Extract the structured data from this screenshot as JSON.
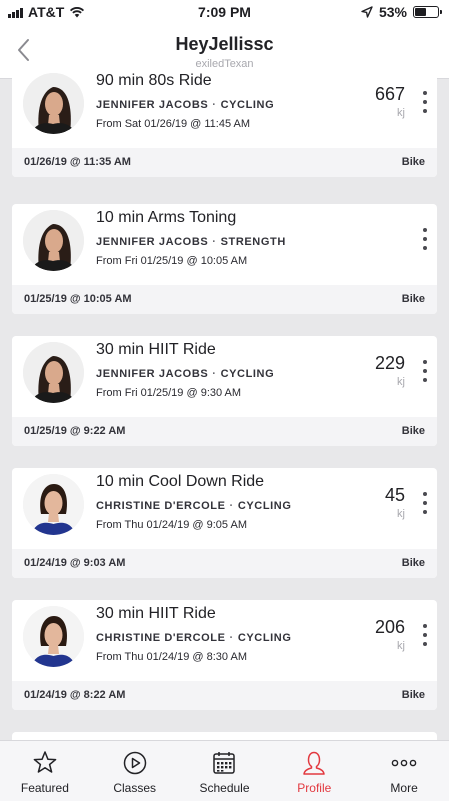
{
  "status_bar": {
    "carrier": "AT&T",
    "time": "7:09 PM",
    "battery_percent": "53%",
    "battery_level": 0.53
  },
  "nav": {
    "title": "HeyJellissc",
    "subtitle": "exiledTexan"
  },
  "rides": [
    {
      "title": "90 min 80s Ride",
      "instructor": "JENNIFER JACOBS",
      "category": "CYCLING",
      "from": "From Sat 01/26/19 @ 11:45 AM",
      "output": "667",
      "unit": "kj",
      "date": "01/26/19 @ 11:35 AM",
      "equipment": "Bike",
      "avatar": "instructor-a"
    },
    {
      "title": "10 min Arms Toning",
      "instructor": "JENNIFER JACOBS",
      "category": "STRENGTH",
      "from": "From Fri 01/25/19 @ 10:05 AM",
      "output": "",
      "unit": "",
      "date": "01/25/19 @ 10:05 AM",
      "equipment": "Bike",
      "avatar": "instructor-a"
    },
    {
      "title": "30 min HIIT Ride",
      "instructor": "JENNIFER JACOBS",
      "category": "CYCLING",
      "from": "From Fri 01/25/19 @ 9:30 AM",
      "output": "229",
      "unit": "kj",
      "date": "01/25/19 @ 9:22 AM",
      "equipment": "Bike",
      "avatar": "instructor-a"
    },
    {
      "title": "10 min Cool Down Ride",
      "instructor": "CHRISTINE D'ERCOLE",
      "category": "CYCLING",
      "from": "From Thu 01/24/19 @ 9:05 AM",
      "output": "45",
      "unit": "kj",
      "date": "01/24/19 @ 9:03 AM",
      "equipment": "Bike",
      "avatar": "instructor-b"
    },
    {
      "title": "30 min HIIT Ride",
      "instructor": "CHRISTINE D'ERCOLE",
      "category": "CYCLING",
      "from": "From Thu 01/24/19 @ 8:30 AM",
      "output": "206",
      "unit": "kj",
      "date": "01/24/19 @ 8:22 AM",
      "equipment": "Bike",
      "avatar": "instructor-b"
    }
  ],
  "tabs": [
    {
      "label": "Featured",
      "icon": "star-icon",
      "active": false
    },
    {
      "label": "Classes",
      "icon": "play-circle-icon",
      "active": false
    },
    {
      "label": "Schedule",
      "icon": "calendar-icon",
      "active": false
    },
    {
      "label": "Profile",
      "icon": "profile-icon",
      "active": true
    },
    {
      "label": "More",
      "icon": "more-dots-icon",
      "active": false
    }
  ],
  "colors": {
    "accent": "#e2383f",
    "background": "#e8e8ea",
    "card": "#ffffff",
    "footer": "#f4f4f6"
  }
}
